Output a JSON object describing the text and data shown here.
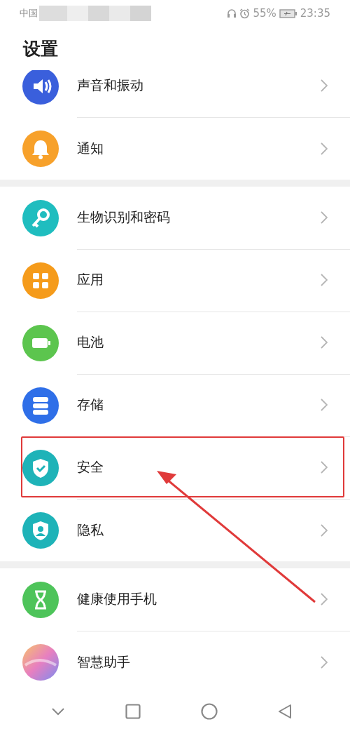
{
  "status_bar": {
    "carrier": "中国",
    "battery": "55%",
    "time": "23:35"
  },
  "title": "设置",
  "groups": [
    {
      "items": [
        {
          "label": "声音和振动",
          "kind": "sound",
          "color": "#3a5fdc",
          "highlighted": false
        },
        {
          "label": "通知",
          "kind": "bell",
          "color": "#f7a12b",
          "highlighted": false
        }
      ]
    },
    {
      "items": [
        {
          "label": "生物识别和密码",
          "kind": "key",
          "color": "#1fbdbf",
          "highlighted": false
        },
        {
          "label": "应用",
          "kind": "apps",
          "color": "#f59b1b",
          "highlighted": false
        },
        {
          "label": "电池",
          "kind": "battery",
          "color": "#5cc54e",
          "highlighted": false
        },
        {
          "label": "存储",
          "kind": "storage",
          "color": "#2f6fe8",
          "highlighted": false
        },
        {
          "label": "安全",
          "kind": "shield",
          "color": "#1eb3b8",
          "highlighted": true
        },
        {
          "label": "隐私",
          "kind": "privacy",
          "color": "#1eb3b8",
          "highlighted": false
        }
      ]
    },
    {
      "items": [
        {
          "label": "健康使用手机",
          "kind": "hourglass",
          "color": "#4ec45a",
          "highlighted": false
        },
        {
          "label": "智慧助手",
          "kind": "orb",
          "highlighted": false
        }
      ]
    }
  ]
}
